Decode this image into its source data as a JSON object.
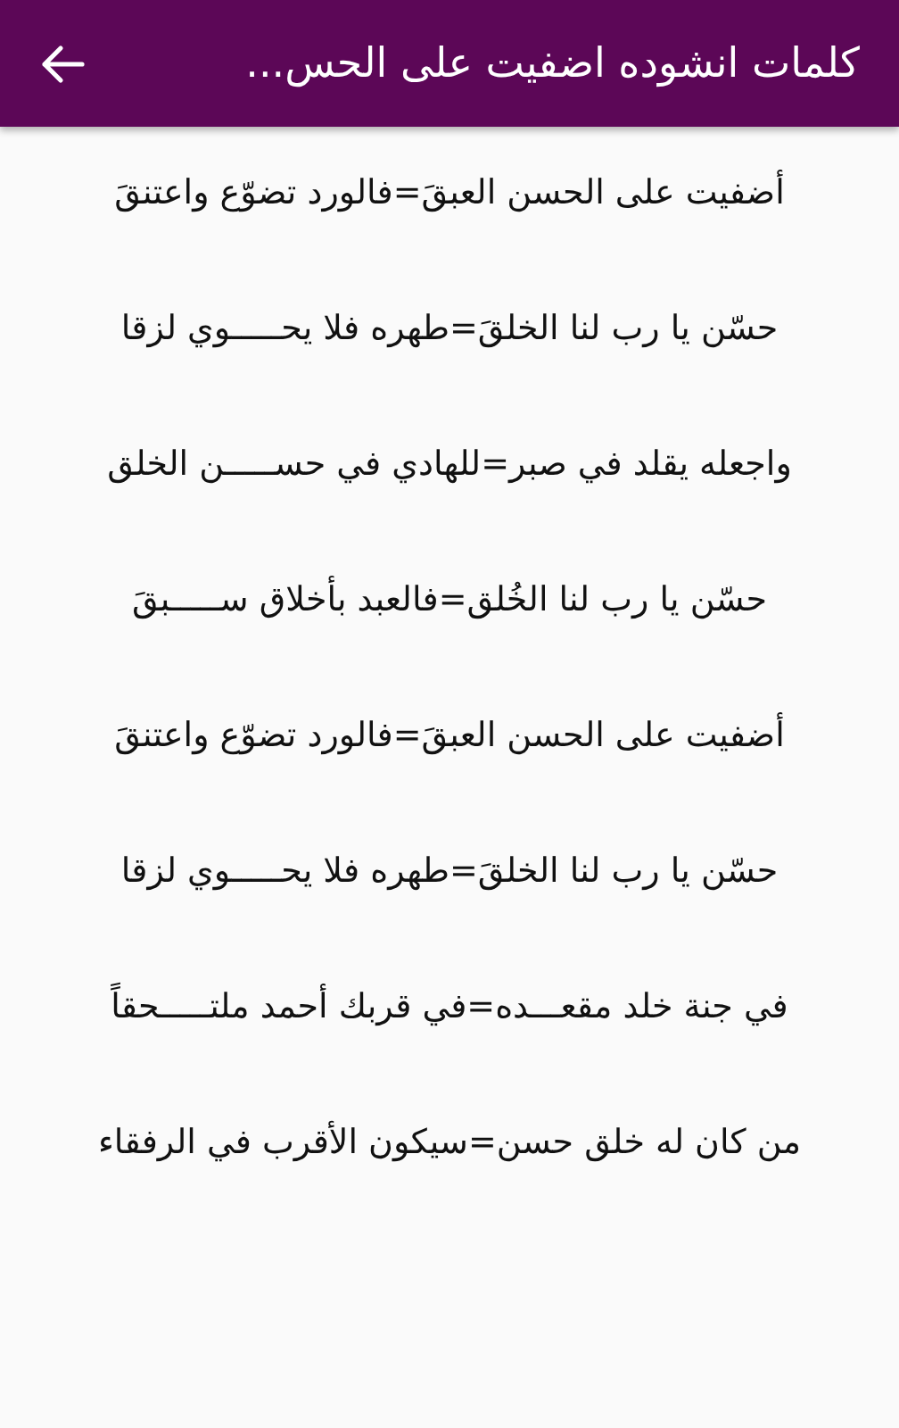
{
  "app_bar": {
    "title": "كلمات انشوده اضفيت على الحس..."
  },
  "verses": [
    "أضفيت على الحسن العبقَ=فالورد تضوّع واعتنقَ",
    "حسّن يا رب لنا الخلقَ=طهره فلا يحـــــوي لزقا",
    "واجعله يقلد في صبر=للهادي في حســـــن الخلق",
    "حسّن يا رب لنا الخُلق=فالعبد بأخلاق ســـــبقَ",
    "أضفيت على الحسن العبقَ=فالورد تضوّع واعتنقَ",
    "حسّن يا رب لنا الخلقَ=طهره فلا يحـــــوي لزقا",
    "في جنة خلد مقعـــده=في قربك أحمد ملتـــــحقاً",
    "من كان له خلق حسن=سيكون الأقرب في الرفقاء"
  ]
}
